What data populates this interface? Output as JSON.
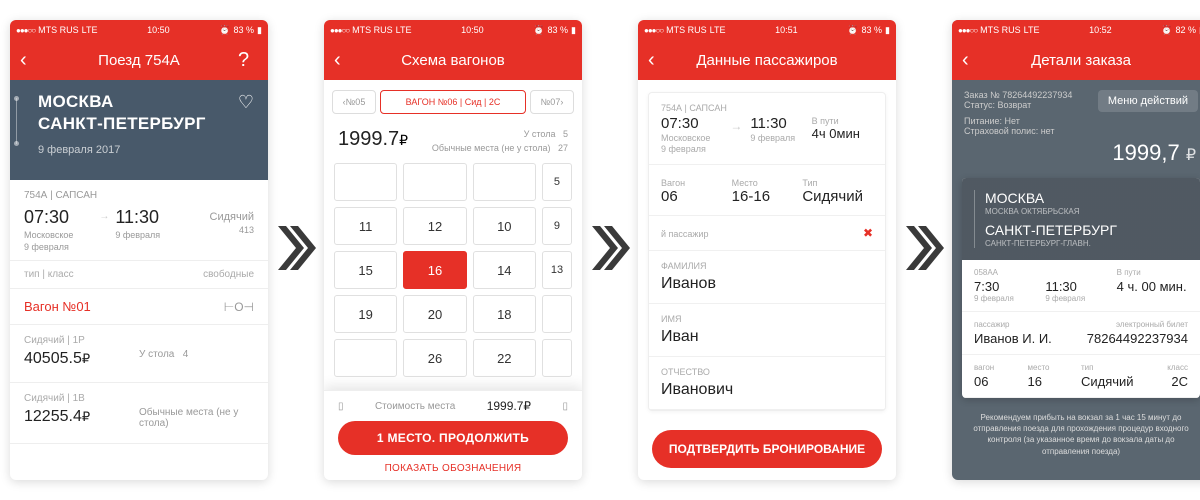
{
  "status": {
    "carrier": "MTS RUS",
    "net": "LTE",
    "alarm": "⏰",
    "battery": "83 %",
    "t1": "10:50",
    "t2": "10:50",
    "t3": "10:51",
    "t4": "10:52",
    "b4": "82 %"
  },
  "s1": {
    "title": "Поезд 754А",
    "from": "МОСКВА",
    "to": "САНКТ-ПЕТЕРБУРГ",
    "date": "9 февраля 2017",
    "train_code": "754А | САПСАН",
    "dep_time": "07:30",
    "arr_time": "11:30",
    "dep_station": "Московское",
    "arr_station": "9 февраля",
    "dep_date": "9 февраля",
    "type": "Сидячий",
    "cap": "413",
    "head_type": "тип | класс",
    "head_free": "свободные",
    "wagon": "Вагон №01",
    "class1_lbl": "Сидячий | 1Р",
    "class1_price": "40505.5",
    "class1_note": "У стола",
    "class1_cnt": "4",
    "class2_lbl": "Сидячий | 1В",
    "class2_price": "12255.4",
    "class2_note": "Обычные места (не у стола)"
  },
  "s2": {
    "title": "Схема вагонов",
    "tab_prev": "‹№05",
    "tab_cur": "ВАГОН №06 | Сид | 2С",
    "tab_next": "№07›",
    "price": "1999.7",
    "legend1": "У стола",
    "legend1_n": "5",
    "legend2": "Обычные места (не у стола)",
    "legend2_n": "27",
    "seats": [
      [
        "",
        "",
        "",
        "5"
      ],
      [
        "11",
        "12",
        "10",
        "9"
      ],
      [
        "15",
        "16",
        "14",
        "13"
      ],
      [
        "19",
        "20",
        "18",
        ""
      ],
      [
        "",
        "26",
        "22",
        ""
      ]
    ],
    "selected": "16",
    "cost_lbl": "Стоимость места",
    "cost_val": "1999.7₽",
    "btn": "1 МЕСТО. ПРОДОЛЖИТЬ",
    "link": "ПОКАЗАТЬ ОБОЗНАЧЕНИЯ"
  },
  "s3": {
    "title": "Данные пассажиров",
    "train": "754А | САПСАН",
    "dep": "07:30",
    "arr": "11:30",
    "dep_st": "Московское",
    "arr_st": "9 февраля",
    "dep_d": "9 февраля",
    "dur_lbl": "В пути",
    "dur": "4ч 0мин",
    "wagon_lbl": "Вагон",
    "wagon": "06",
    "seat_lbl": "Место",
    "seat": "16-16",
    "type_lbl": "Тип",
    "type": "Сидячий",
    "pass_lbl": "й пассажир",
    "surname_lbl": "ФАМИЛИЯ",
    "surname": "Иванов",
    "name_lbl": "ИМЯ",
    "name": "Иван",
    "patr_lbl": "ОТЧЕСТВО",
    "patr": "Иванович",
    "btn": "ПОДТВЕРДИТЬ БРОНИРОВАНИЕ"
  },
  "s4": {
    "title": "Детали заказа",
    "order_lbl": "Заказ № 78264492237934",
    "status_lbl": "Статус: Возврат",
    "meal": "Питание: Нет",
    "ins": "Страховой полис: нет",
    "menu": "Меню действий",
    "price": "1999,7",
    "from": "МОСКВА",
    "from_st": "МОСКВА ОКТЯБРЬСКАЯ",
    "to": "САНКТ-ПЕТЕРБУРГ",
    "to_st": "САНКТ-ПЕТЕРБУРГ-ГЛАВН.",
    "train_lbl": "058АА",
    "dep": "7:30",
    "arr": "11:30",
    "dep_d": "9 февраля",
    "arr_d": "9 февраля",
    "dur_lbl": "В пути",
    "dur": "4 ч. 00 мин.",
    "pass_lbl": "пассажир",
    "pass": "Иванов И. И.",
    "ticket_lbl": "электронный билет",
    "ticket": "78264492237934",
    "wagon_lbl": "вагон",
    "wagon": "06",
    "seat_lbl": "место",
    "seat": "16",
    "type_lbl": "тип",
    "type": "Сидячий",
    "class_lbl": "класс",
    "class": "2С",
    "note": "Рекомендуем прибыть на вокзал за 1 час 15 минут до отправления поезда для прохождения процедур входного контроля (за указанное время до вокзала даты до отправления поезда)"
  }
}
